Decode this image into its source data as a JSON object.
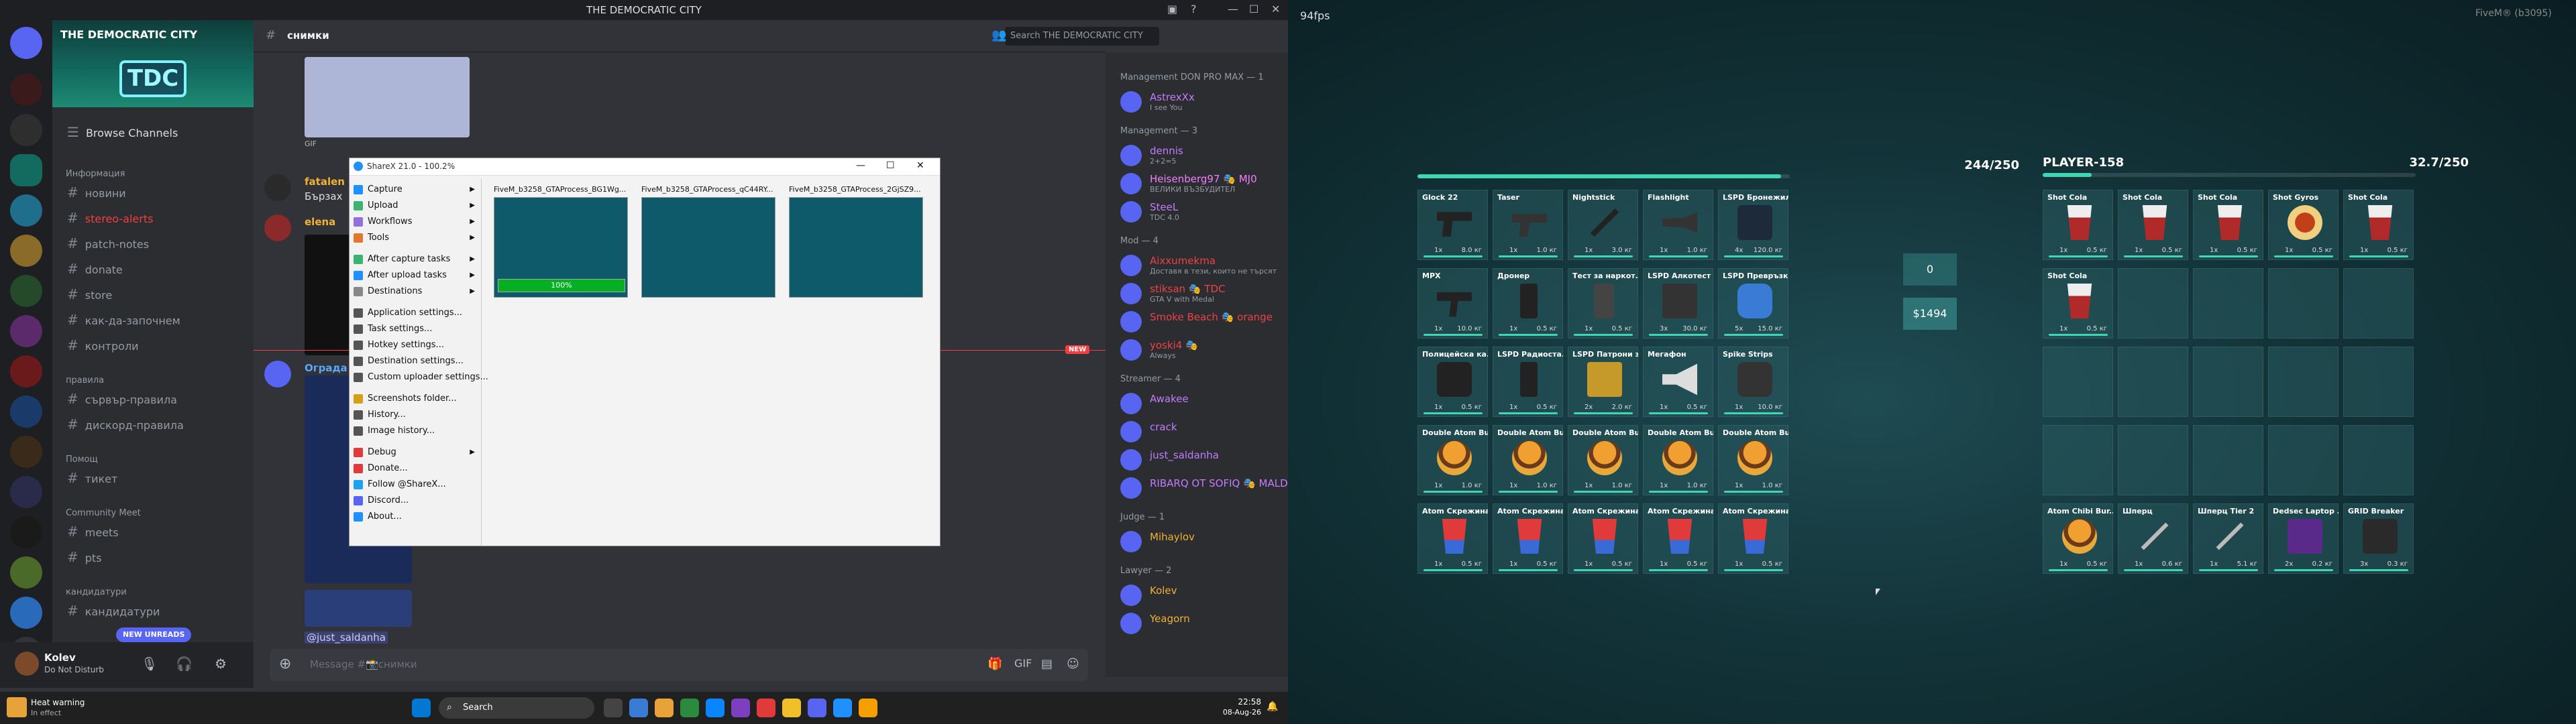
{
  "discord": {
    "window_title": "THE DEMOCRATIC CITY",
    "server_name": "THE DEMOCRATIC CITY",
    "browse_channels": "Browse Channels",
    "categories": [
      {
        "label": "Информация",
        "channels": [
          "новини",
          "stereo-alerts",
          "patch-notes",
          "donate",
          "store",
          "как-да-започнем",
          "контроли"
        ]
      },
      {
        "label": "правила",
        "channels": [
          "сървър-правила",
          "дискорд-правила"
        ]
      },
      {
        "label": "Помощ",
        "channels": [
          "тикет"
        ]
      },
      {
        "label": "Community Meet",
        "channels": [
          "meets",
          "pts"
        ]
      },
      {
        "label": "кандидатури",
        "channels": [
          "кандидатури"
        ]
      }
    ],
    "new_unreads": "NEW UNREADS",
    "user": {
      "name": "Kolev",
      "status": "Do Not Disturb"
    },
    "channel_header": "снимки",
    "search_placeholder": "Search THE DEMOCRATIC CITY",
    "messages": [
      {
        "author": "fatalen",
        "text": "Бързах"
      },
      {
        "author": "elena"
      },
      {
        "author": "Ограда",
        "text": "@just_saldanha"
      }
    ],
    "gif_label": "GIF",
    "new_label": "NEW",
    "composer_placeholder": "Message #📸снимки",
    "members": [
      {
        "category": "Management DON PRO MAX — 1",
        "items": [
          {
            "name": "AstrexXx",
            "status": "I see You",
            "color": "#c27cff"
          }
        ]
      },
      {
        "category": "Management — 3",
        "items": [
          {
            "name": "dennis",
            "status": "2+2=5",
            "color": "#c27cff"
          },
          {
            "name": "Heisenberg97 🎭 MJ0",
            "status": "ВЕЛИКИ ВЪЗБУДИТЕЛ",
            "color": "#f47fff"
          },
          {
            "name": "SteeL",
            "status": "TDC 4.0",
            "color": "#c27cff"
          }
        ]
      },
      {
        "category": "Mod — 4",
        "items": [
          {
            "name": "Aixxumekma",
            "status": "Доставя в тези, които не търсят",
            "color": "#ed4245"
          },
          {
            "name": "stiksan 🎭 TDC",
            "status": "GTA V with Medal",
            "color": "#ed4245"
          },
          {
            "name": "Smoke Beach 🎭 orange",
            "status": "",
            "color": "#ed4245"
          },
          {
            "name": "yoski4 🎭",
            "status": "Always",
            "color": "#ed4245"
          }
        ]
      },
      {
        "category": "Streamer — 4",
        "items": [
          {
            "name": "Awakee",
            "status": "",
            "color": "#c27cff"
          },
          {
            "name": "crack",
            "status": "",
            "color": "#c27cff"
          },
          {
            "name": "just_saldanha",
            "status": "",
            "color": "#c27cff"
          },
          {
            "name": "RIBARQ OT SOFIQ 🎭 MALD",
            "status": "",
            "color": "#c27cff"
          }
        ]
      },
      {
        "category": "Judge — 1",
        "items": [
          {
            "name": "Mihaylov",
            "status": "",
            "color": "#f0b232"
          }
        ]
      },
      {
        "category": "Lawyer — 2",
        "items": [
          {
            "name": "Kolev",
            "status": "",
            "color": "#f0b232"
          },
          {
            "name": "Yeagorn",
            "status": "",
            "color": "#f0b232"
          }
        ]
      }
    ],
    "sharex": {
      "title": "ShareX 21.0 - 100.2%",
      "menu": [
        "Capture",
        "Upload",
        "Workflows",
        "Tools",
        "After capture tasks",
        "After upload tasks",
        "Destinations",
        "Application settings...",
        "Task settings...",
        "Hotkey settings...",
        "Destination settings...",
        "Custom uploader settings...",
        "Screenshots folder...",
        "History...",
        "Image history...",
        "Debug",
        "Donate...",
        "Follow @ShareX...",
        "Discord...",
        "About..."
      ],
      "thumbs": [
        "FiveM_b3258_GTAProcess_BG1Wg...",
        "FiveM_b3258_GTAProcess_qC44RY...",
        "FiveM_b3258_GTAProcess_2GjSZ9..."
      ],
      "progress": "100%",
      "progress_value": 1.0
    },
    "taskbar": {
      "search": "Search",
      "time": "22:58",
      "date": "08-Aug-26",
      "weather_title": "Heat warning",
      "weather_sub": "In effect"
    }
  },
  "game": {
    "fps": "94fps",
    "build": "FiveM® (b3095)",
    "left_weight": "244/250",
    "left_weight_fill": 0.976,
    "player_name": "PLAYER-158",
    "player_weight": "32.7/250",
    "player_weight_fill": 0.131,
    "give_amount": "0",
    "cash": "$1494",
    "left_items": [
      {
        "name": "Glock 22",
        "count": "1x",
        "weight": "8.0 кг",
        "icon": "pistol-icon"
      },
      {
        "name": "Taser",
        "count": "1x",
        "weight": "1.0 кг",
        "icon": "taser-icon"
      },
      {
        "name": "Nightstick",
        "count": "1x",
        "weight": "3.0 кг",
        "icon": "baton-icon"
      },
      {
        "name": "Flashlight",
        "count": "1x",
        "weight": "1.0 кг",
        "icon": "flashlight-icon"
      },
      {
        "name": "LSPD Бронежил...",
        "count": "4x",
        "weight": "120.0 кг",
        "icon": "vest-icon"
      },
      {
        "name": "MPX",
        "count": "1x",
        "weight": "10.0 кг",
        "icon": "smg-icon"
      },
      {
        "name": "Дронер",
        "count": "1x",
        "weight": "0.5 кг",
        "icon": "radio-icon"
      },
      {
        "name": "Тест за наркот...",
        "count": "1x",
        "weight": "0.5 кг",
        "icon": "test-kit-icon"
      },
      {
        "name": "LSPD Алкотест",
        "count": "3x",
        "weight": "30.0 кг",
        "icon": "breathalyzer-icon"
      },
      {
        "name": "LSPD Превръзка",
        "count": "5x",
        "weight": "15.0 кг",
        "icon": "bandage-icon"
      },
      {
        "name": "Полицейска ка...",
        "count": "1x",
        "weight": "0.5 кг",
        "icon": "camera-icon"
      },
      {
        "name": "LSPD Радиоста...",
        "count": "1x",
        "weight": "0.5 кг",
        "icon": "radio-icon"
      },
      {
        "name": "LSPD Патрони з...",
        "count": "2x",
        "weight": "2.0 кг",
        "icon": "ammo-icon"
      },
      {
        "name": "Мегафон",
        "count": "1x",
        "weight": "0.5 кг",
        "icon": "megaphone-icon"
      },
      {
        "name": "Spike Strips",
        "count": "1x",
        "weight": "10.0 кг",
        "icon": "spike-strip-icon"
      },
      {
        "name": "Double Atom Bu...",
        "count": "1x",
        "weight": "1.0 кг",
        "icon": "burger-icon"
      },
      {
        "name": "Double Atom Bu...",
        "count": "1x",
        "weight": "1.0 кг",
        "icon": "burger-icon"
      },
      {
        "name": "Double Atom Bu...",
        "count": "1x",
        "weight": "1.0 кг",
        "icon": "burger-icon"
      },
      {
        "name": "Double Atom Bu...",
        "count": "1x",
        "weight": "1.0 кг",
        "icon": "burger-icon"
      },
      {
        "name": "Double Atom Bu...",
        "count": "1x",
        "weight": "1.0 кг",
        "icon": "burger-icon"
      },
      {
        "name": "Atom Скрежина",
        "count": "1x",
        "weight": "0.5 кг",
        "icon": "slush-icon"
      },
      {
        "name": "Atom Скрежина",
        "count": "1x",
        "weight": "0.5 кг",
        "icon": "slush-icon"
      },
      {
        "name": "Atom Скрежина",
        "count": "1x",
        "weight": "0.5 кг",
        "icon": "slush-icon"
      },
      {
        "name": "Atom Скрежина",
        "count": "1x",
        "weight": "0.5 кг",
        "icon": "slush-icon"
      },
      {
        "name": "Atom Скрежина",
        "count": "1x",
        "weight": "0.5 кг",
        "icon": "slush-icon"
      }
    ],
    "right_items": [
      {
        "name": "Shot Cola",
        "count": "1x",
        "weight": "0.5 кг",
        "icon": "cola-icon"
      },
      {
        "name": "Shot Cola",
        "count": "1x",
        "weight": "0.5 кг",
        "icon": "cola-icon"
      },
      {
        "name": "Shot Cola",
        "count": "1x",
        "weight": "0.5 кг",
        "icon": "cola-icon"
      },
      {
        "name": "Shot Gyros",
        "count": "1x",
        "weight": "0.5 кг",
        "icon": "gyros-icon"
      },
      {
        "name": "Shot Cola",
        "count": "1x",
        "weight": "0.5 кг",
        "icon": "cola-icon"
      },
      {
        "name": "Shot Cola",
        "count": "1x",
        "weight": "0.5 кг",
        "icon": "cola-icon"
      },
      null,
      null,
      null,
      null,
      null,
      null,
      null,
      null,
      null,
      null,
      null,
      null,
      null,
      null,
      {
        "name": "Atom Chibi Bur...",
        "count": "1x",
        "weight": "0.5 кг",
        "icon": "burger-icon"
      },
      {
        "name": "Шперц",
        "count": "1x",
        "weight": "0.6 кг",
        "icon": "lockpick-icon"
      },
      {
        "name": "Шперц Tier 2",
        "count": "1x",
        "weight": "5.1 кг",
        "icon": "lockpick-icon"
      },
      {
        "name": "Dedsec Laptop ...",
        "count": "2x",
        "weight": "0.2 кг",
        "icon": "laptop-icon"
      },
      {
        "name": "GRID Breaker",
        "count": "3x",
        "weight": "0.3 кг",
        "icon": "device-icon"
      }
    ]
  }
}
